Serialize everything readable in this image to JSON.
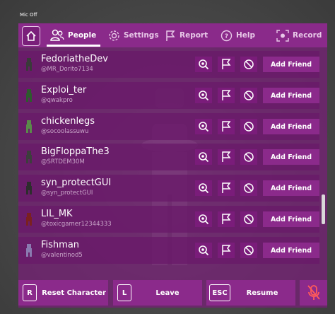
{
  "mic_status": "Mic Off",
  "tabs": [
    {
      "label": "People",
      "icon": "people-icon",
      "active": true
    },
    {
      "label": "Settings",
      "icon": "gear-icon",
      "active": false
    },
    {
      "label": "Report",
      "icon": "flag-icon",
      "active": false
    },
    {
      "label": "Help",
      "icon": "help-icon",
      "active": false
    },
    {
      "label": "Record",
      "icon": "record-icon",
      "active": false
    }
  ],
  "players": [
    {
      "name": "FedoriatheDev",
      "handle": "@MR_Dorito7134",
      "avatar_color": "#3a3a3a",
      "action": "Add Friend"
    },
    {
      "name": "Exploi_ter",
      "handle": "@qwakpro",
      "avatar_color": "#2e5a2e",
      "action": "Add Friend"
    },
    {
      "name": "chickenlegs",
      "handle": "@socoolassuwu",
      "avatar_color": "#5a8a4a",
      "action": "Add Friend"
    },
    {
      "name": "BigFloppaThe3",
      "handle": "@SRTDEM30M",
      "avatar_color": "#3d3d3d",
      "action": "Add Friend"
    },
    {
      "name": "syn_protectGUI",
      "handle": "@syn_protectGUI",
      "avatar_color": "#2d2d2d",
      "action": "Add Friend"
    },
    {
      "name": "LIL_MK",
      "handle": "@toxicgamer12344333",
      "avatar_color": "#7a2020",
      "action": "Add Friend"
    },
    {
      "name": "Fishman",
      "handle": "@valentinod5",
      "avatar_color": "#8a7ab0",
      "action": "Add Friend"
    }
  ],
  "bottom": {
    "reset": {
      "key": "R",
      "label": "Reset Character"
    },
    "leave": {
      "key": "L",
      "label": "Leave"
    },
    "resume": {
      "key": "ESC",
      "label": "Resume"
    }
  },
  "colors": {
    "accent": "#8b2a8b",
    "row": "#691969",
    "text": "#ffffff"
  }
}
